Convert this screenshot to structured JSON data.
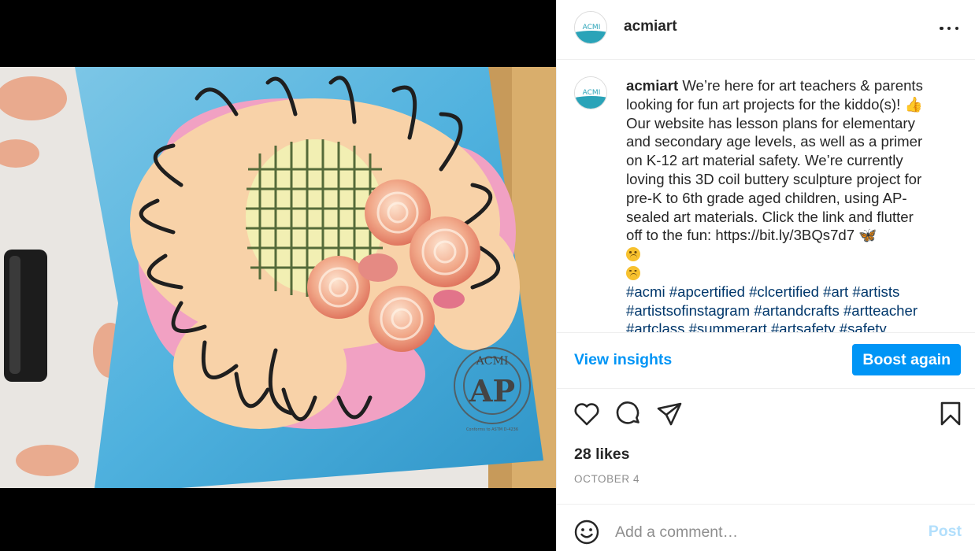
{
  "media": {
    "watermark_top": "ACMI",
    "watermark_main": "AP",
    "watermark_ring": "ART & CREATIVE MATERIALS INSTITUTE, INC.",
    "watermark_small": "Conforms to ASTM D-4236"
  },
  "header": {
    "avatar_text": "ACMI",
    "username": "acmiart"
  },
  "caption": {
    "username": "acmiart",
    "lines": [
      " We’re here for art teachers & parents",
      "looking for fun art projects for the kiddo(s)! 👍",
      "Our website has lesson plans for elementary",
      "and secondary age levels, as well as a primer",
      "on K-12 art material safety. We’re currently",
      "loving this 3D coil buttery sculpture project for",
      "pre-K to 6th grade aged children, using AP-",
      "sealed art materials. Click the link and flutter",
      "off to the fun: https://bit.ly/3BQs7d7 🦋"
    ],
    "hashtags": [
      [
        "#acmi",
        "#apcertified",
        "#clcertified",
        "#art",
        "#artists"
      ],
      [
        "#artistsofinstagram",
        "#artandcrafts",
        "#artteacher"
      ],
      [
        "#artclass",
        "#summerart",
        "#artsafety",
        "#safety"
      ]
    ]
  },
  "actions": {
    "view_insights": "View insights",
    "boost_again": "Boost again"
  },
  "engagement": {
    "likes": "28 likes",
    "date": "OCTOBER 4"
  },
  "comment": {
    "placeholder": "Add a comment…",
    "post_label": "Post"
  },
  "colors": {
    "link_blue": "#0095f6",
    "hashtag_blue": "#00376b",
    "post_disabled": "#b2dffc",
    "text": "#262626",
    "muted": "#8e8e8e"
  },
  "icons": [
    "more-icon",
    "heart-icon",
    "comment-icon",
    "share-icon",
    "bookmark-icon",
    "emoji-icon"
  ]
}
